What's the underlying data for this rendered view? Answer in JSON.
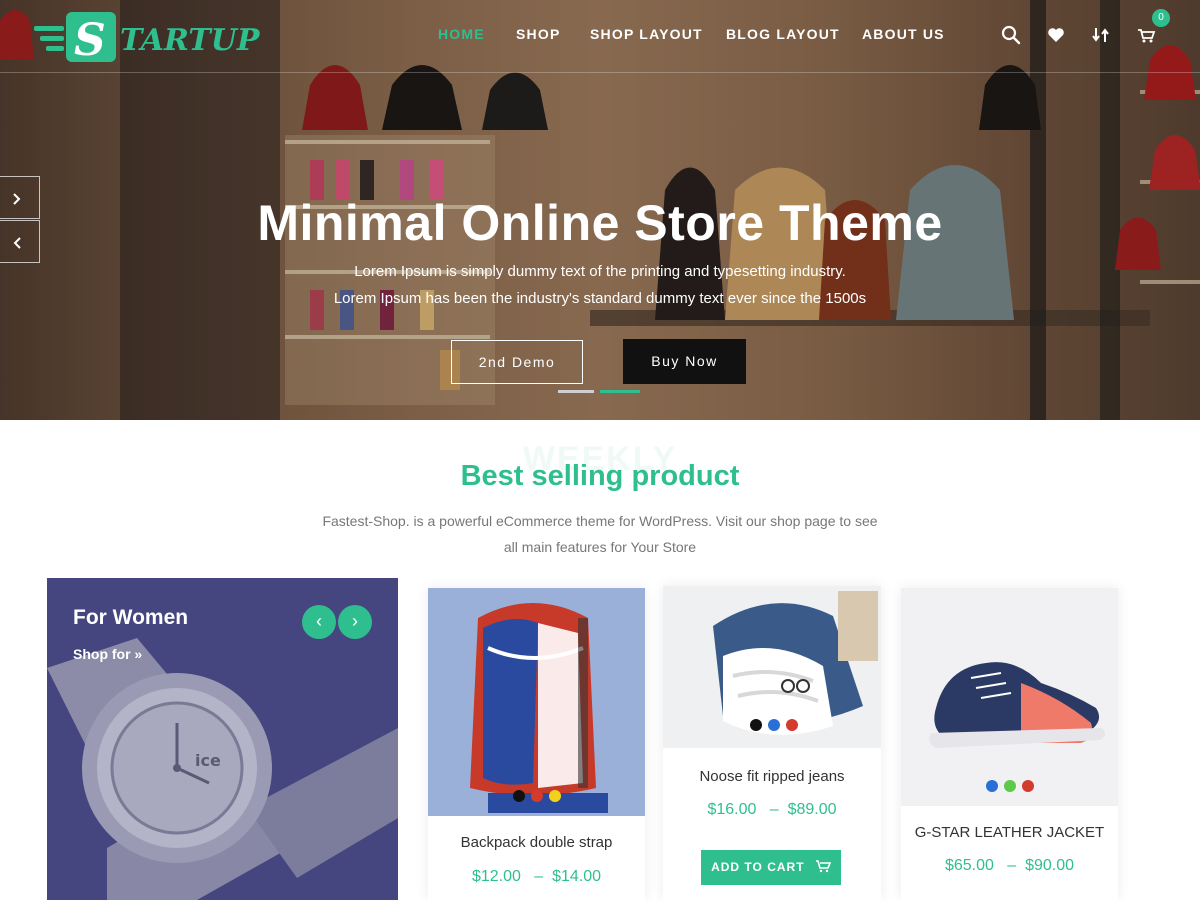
{
  "header": {
    "logo_text": "STARTUP",
    "nav": [
      {
        "label": "HOME",
        "active": true
      },
      {
        "label": "SHOP",
        "active": false
      },
      {
        "label": "SHOP LAYOUT",
        "active": false
      },
      {
        "label": "BLOG LAYOUT",
        "active": false
      },
      {
        "label": "ABOUT US",
        "active": false
      }
    ],
    "icons": [
      "search-icon",
      "heart-icon",
      "compare-icon",
      "cart-icon"
    ],
    "cart_count": "0"
  },
  "hero": {
    "title": "Minimal Online Store Theme",
    "subtitle_line1": "Lorem Ipsum is simply dummy text of the printing and typesetting industry.",
    "subtitle_line2": "Lorem Ipsum has been the industry's standard dummy text ever since the 1500s",
    "btn_secondary": "2nd Demo",
    "btn_primary": "Buy Now",
    "slides": 2,
    "active_slide": 2
  },
  "section": {
    "watermark": "WEEKLY",
    "title": "Best selling product",
    "desc_line1": "Fastest-Shop. is a powerful eCommerce theme for WordPress. Visit our shop page to see",
    "desc_line2": "all main features for Your Store"
  },
  "promo": {
    "title": "For Women",
    "link": "Shop for »"
  },
  "products": [
    {
      "name": "Backpack double strap",
      "price_min": "$12.00",
      "price_sep": "–",
      "price_max": "$14.00",
      "swatches": [
        "#111111",
        "#d23b2e",
        "#f2d21b"
      ]
    },
    {
      "name": "Noose fit ripped jeans",
      "price_min": "$16.00",
      "price_sep": "–",
      "price_max": "$89.00",
      "swatches": [
        "#111111",
        "#2a6fd6",
        "#d23b2e"
      ],
      "button": "ADD TO CART"
    },
    {
      "name": "G-STAR LEATHER JACKET",
      "price_min": "$65.00",
      "price_sep": "–",
      "price_max": "$90.00",
      "swatches": [
        "#2a6fd6",
        "#5cc94a",
        "#d23b2e"
      ]
    }
  ],
  "colors": {
    "accent": "#2fbf8f",
    "dark": "#111111",
    "promo_bg": "#4a4a8a"
  }
}
